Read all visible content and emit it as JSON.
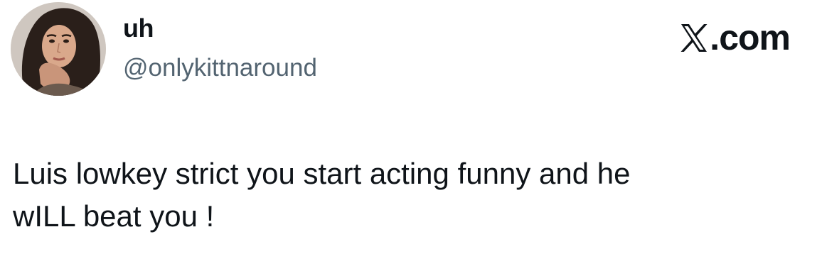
{
  "tweet": {
    "author": {
      "display_name": "uh",
      "handle": "@onlykittnaround",
      "avatar": "profile-photo"
    },
    "brand": {
      "icon": "x-logo-icon",
      "domain": ".com"
    },
    "text": "Luis lowkey strict you start acting funny and he\nwILL beat you !"
  },
  "colors": {
    "text_primary": "#0f1419",
    "text_secondary": "#536471",
    "background": "#ffffff"
  }
}
